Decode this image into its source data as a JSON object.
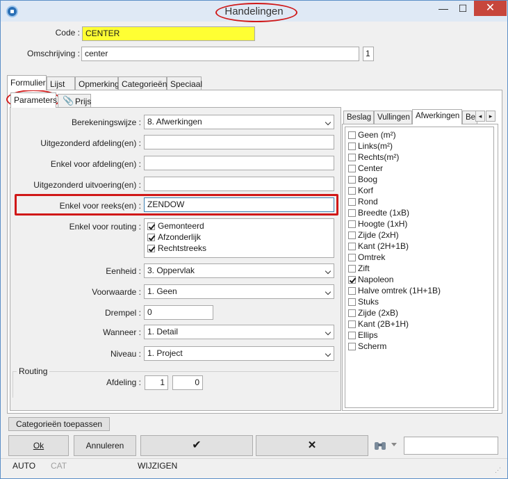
{
  "window": {
    "title": "Handelingen",
    "minimize_glyph": "—",
    "maximize_glyph": "☐",
    "close_glyph": "✕"
  },
  "header": {
    "code_label": "Code :",
    "code_value": "CENTER",
    "omschrijving_label": "Omschrijving :",
    "omschrijving_value": "center",
    "omschrijving_badge": "1"
  },
  "main_tabs": [
    "Formulier",
    "Lijst",
    "Opmerking",
    "Categorieën",
    "Speciaal"
  ],
  "sub_tabs": {
    "parameters": "Parameters",
    "prijs": "Prijs"
  },
  "form": {
    "berekeningswijze_label": "Berekeningswijze :",
    "berekeningswijze_value": "8. Afwerkingen",
    "uitgezonderd_afdeling_label": "Uitgezonderd afdeling(en) :",
    "uitgezonderd_afdeling_value": "",
    "enkel_afdeling_label": "Enkel voor afdeling(en) :",
    "enkel_afdeling_value": "",
    "uitgezonderd_uitvoering_label": "Uitgezonderd uitvoering(en) :",
    "uitgezonderd_uitvoering_value": "",
    "enkel_reeks_label": "Enkel voor reeks(en) :",
    "enkel_reeks_value": "ZENDOW",
    "routing_label": "Enkel voor routing :",
    "routing_options": [
      {
        "label": "Gemonteerd",
        "checked": true
      },
      {
        "label": "Afzonderlijk",
        "checked": true
      },
      {
        "label": "Rechtstreeks",
        "checked": true
      }
    ],
    "eenheid_label": "Eenheid :",
    "eenheid_value": "3. Oppervlak",
    "voorwaarde_label": "Voorwaarde :",
    "voorwaarde_value": "1. Geen",
    "drempel_label": "Drempel :",
    "drempel_value": "0",
    "wanneer_label": "Wanneer :",
    "wanneer_value": "1. Detail",
    "niveau_label": "Niveau :",
    "niveau_value": "1. Project"
  },
  "routing_group": {
    "title": "Routing",
    "afdeling_label": "Afdeling :",
    "afdeling_from": "1",
    "afdeling_to": "0"
  },
  "right_tabs": [
    "Beslag",
    "Vullingen",
    "Afwerkingen",
    "Be"
  ],
  "right_list": [
    {
      "label": "Geen (m²)",
      "checked": false
    },
    {
      "label": "Links(m²)",
      "checked": false
    },
    {
      "label": "Rechts(m²)",
      "checked": false
    },
    {
      "label": "Center",
      "checked": false
    },
    {
      "label": "Boog",
      "checked": false
    },
    {
      "label": "Korf",
      "checked": false
    },
    {
      "label": "Rond",
      "checked": false
    },
    {
      "label": "Breedte (1xB)",
      "checked": false
    },
    {
      "label": "Hoogte (1xH)",
      "checked": false
    },
    {
      "label": "Zijde (2xH)",
      "checked": false
    },
    {
      "label": "Kant (2H+1B)",
      "checked": false
    },
    {
      "label": "Omtrek",
      "checked": false
    },
    {
      "label": "Zift",
      "checked": false
    },
    {
      "label": "Napoleon",
      "checked": true
    },
    {
      "label": "Halve omtrek (1H+1B)",
      "checked": false
    },
    {
      "label": "Stuks",
      "checked": false
    },
    {
      "label": "Zijde (2xB)",
      "checked": false
    },
    {
      "label": "Kant (2B+1H)",
      "checked": false
    },
    {
      "label": "Ellips",
      "checked": false
    },
    {
      "label": "Scherm",
      "checked": false
    }
  ],
  "buttons": {
    "categorieen_toepassen": "Categorieën toepassen",
    "ok": "Ok",
    "annuleren": "Annuleren",
    "confirm": "✔",
    "cancel": "✕",
    "search_icon": "binoculars-icon",
    "search_value": ""
  },
  "statusbar": {
    "auto": "AUTO",
    "cat": "CAT",
    "mode": "WIJZIGEN"
  },
  "colors": {
    "code_highlight": "#ffff33",
    "annotation_red": "#d01818"
  }
}
